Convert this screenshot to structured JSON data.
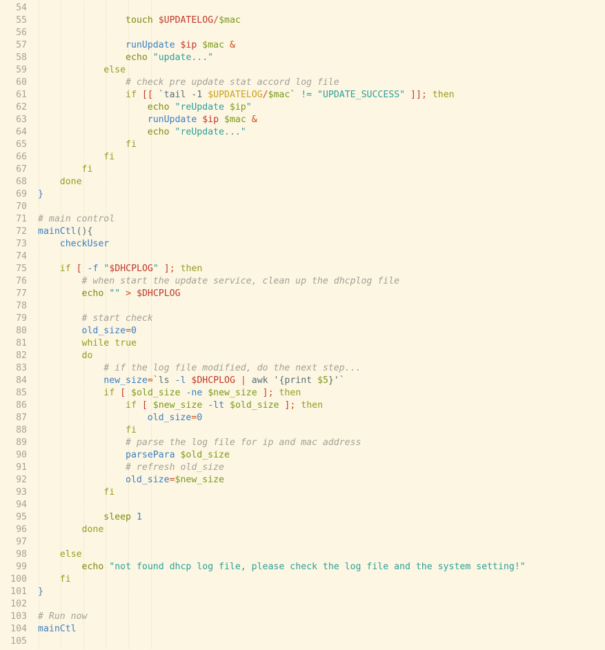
{
  "editor": {
    "theme_name": "solarized-light",
    "language": "bash",
    "colors": {
      "background": "#fdf6e3",
      "gutter_text": "#a9a295",
      "foreground": "#586e75",
      "comment": "#a2a096",
      "keyword": "#9a9a1f",
      "function": "#3a7fc1",
      "variable_green": "#7a9a1a",
      "variable_red": "#c0392b",
      "variable_gold": "#c9a21a",
      "string": "#2aa198",
      "operator": "#cb4b16",
      "bracket": "#c0392b",
      "indent_guide": "#d8d0bb"
    },
    "first_line_number": 54,
    "last_line_number": 105,
    "line_numbers": [
      54,
      55,
      56,
      57,
      58,
      59,
      60,
      61,
      62,
      63,
      64,
      65,
      66,
      67,
      68,
      69,
      70,
      71,
      72,
      73,
      74,
      75,
      76,
      77,
      78,
      79,
      80,
      81,
      82,
      83,
      84,
      85,
      86,
      87,
      88,
      89,
      90,
      91,
      92,
      93,
      94,
      95,
      96,
      97,
      98,
      99,
      100,
      101,
      102,
      103,
      104,
      105
    ],
    "lines": [
      {
        "n": 54,
        "text": ""
      },
      {
        "n": 55,
        "text": "                touch $UPDATELOG/$mac"
      },
      {
        "n": 56,
        "text": ""
      },
      {
        "n": 57,
        "text": "                runUpdate $ip $mac &"
      },
      {
        "n": 58,
        "text": "                echo \"update...\""
      },
      {
        "n": 59,
        "text": "            else"
      },
      {
        "n": 60,
        "text": "                # check pre update stat accord log file"
      },
      {
        "n": 61,
        "text": "                if [[ `tail -1 $UPDATELOG/$mac` != \"UPDATE_SUCCESS\" ]]; then"
      },
      {
        "n": 62,
        "text": "                    echo \"reUpdate $ip\""
      },
      {
        "n": 63,
        "text": "                    runUpdate $ip $mac &"
      },
      {
        "n": 64,
        "text": "                    echo \"reUpdate...\""
      },
      {
        "n": 65,
        "text": "                fi"
      },
      {
        "n": 66,
        "text": "            fi"
      },
      {
        "n": 67,
        "text": "        fi"
      },
      {
        "n": 68,
        "text": "    done"
      },
      {
        "n": 69,
        "text": "}"
      },
      {
        "n": 70,
        "text": ""
      },
      {
        "n": 71,
        "text": "# main control"
      },
      {
        "n": 72,
        "text": "mainCtl(){"
      },
      {
        "n": 73,
        "text": "    checkUser"
      },
      {
        "n": 74,
        "text": ""
      },
      {
        "n": 75,
        "text": "    if [ -f \"$DHCPLOG\" ]; then"
      },
      {
        "n": 76,
        "text": "        # when start the update service, clean up the dhcplog file"
      },
      {
        "n": 77,
        "text": "        echo \"\" > $DHCPLOG"
      },
      {
        "n": 78,
        "text": ""
      },
      {
        "n": 79,
        "text": "        # start check"
      },
      {
        "n": 80,
        "text": "        old_size=0"
      },
      {
        "n": 81,
        "text": "        while true"
      },
      {
        "n": 82,
        "text": "        do"
      },
      {
        "n": 83,
        "text": "            # if the log file modified, do the next step..."
      },
      {
        "n": 84,
        "text": "            new_size=`ls -l $DHCPLOG | awk '{print $5}'`"
      },
      {
        "n": 85,
        "text": "            if [ $old_size -ne $new_size ]; then"
      },
      {
        "n": 86,
        "text": "                if [ $new_size -lt $old_size ]; then"
      },
      {
        "n": 87,
        "text": "                    old_size=0"
      },
      {
        "n": 88,
        "text": "                fi"
      },
      {
        "n": 89,
        "text": "                # parse the log file for ip and mac address"
      },
      {
        "n": 90,
        "text": "                parsePara $old_size"
      },
      {
        "n": 91,
        "text": "                # refresh old_size"
      },
      {
        "n": 92,
        "text": "                old_size=$new_size"
      },
      {
        "n": 93,
        "text": "            fi"
      },
      {
        "n": 94,
        "text": ""
      },
      {
        "n": 95,
        "text": "            sleep 1"
      },
      {
        "n": 96,
        "text": "        done"
      },
      {
        "n": 97,
        "text": ""
      },
      {
        "n": 98,
        "text": "    else"
      },
      {
        "n": 99,
        "text": "        echo \"not found dhcp log file, please check the log file and the system setting!\""
      },
      {
        "n": 100,
        "text": "    fi"
      },
      {
        "n": 101,
        "text": "}"
      },
      {
        "n": 102,
        "text": ""
      },
      {
        "n": 103,
        "text": "# Run now"
      },
      {
        "n": 104,
        "text": "mainCtl"
      },
      {
        "n": 105,
        "text": ""
      }
    ],
    "tokens": {
      "54": [],
      "55": [
        [
          "plain",
          "                "
        ],
        [
          "builtin",
          "touch"
        ],
        [
          "plain",
          " "
        ],
        [
          "var2",
          "$UPDATELOG"
        ],
        [
          "op",
          "/"
        ],
        [
          "var",
          "$mac"
        ]
      ],
      "56": [],
      "57": [
        [
          "plain",
          "                "
        ],
        [
          "func",
          "runUpdate"
        ],
        [
          "plain",
          " "
        ],
        [
          "var2",
          "$ip"
        ],
        [
          "plain",
          " "
        ],
        [
          "var",
          "$mac"
        ],
        [
          "plain",
          " "
        ],
        [
          "op",
          "&"
        ]
      ],
      "58": [
        [
          "plain",
          "                "
        ],
        [
          "builtin",
          "echo"
        ],
        [
          "plain",
          " "
        ],
        [
          "str",
          "\"update...\""
        ]
      ],
      "59": [
        [
          "plain",
          "            "
        ],
        [
          "kw",
          "else"
        ]
      ],
      "60": [
        [
          "plain",
          "                "
        ],
        [
          "comment",
          "# check pre update stat accord log file"
        ]
      ],
      "61": [
        [
          "plain",
          "                "
        ],
        [
          "kw",
          "if"
        ],
        [
          "plain",
          " "
        ],
        [
          "brk",
          "[["
        ],
        [
          "plain",
          " `tail -1 "
        ],
        [
          "var3",
          "$UPDATELOG"
        ],
        [
          "op",
          "/"
        ],
        [
          "var",
          "$mac"
        ],
        [
          "plain",
          "` "
        ],
        [
          "str",
          "!="
        ],
        [
          "plain",
          " "
        ],
        [
          "str",
          "\"UPDATE_SUCCESS\""
        ],
        [
          "plain",
          " "
        ],
        [
          "brk",
          "]]"
        ],
        [
          "op",
          ";"
        ],
        [
          "plain",
          " "
        ],
        [
          "kw",
          "then"
        ]
      ],
      "62": [
        [
          "plain",
          "                    "
        ],
        [
          "builtin",
          "echo"
        ],
        [
          "plain",
          " "
        ],
        [
          "str",
          "\"reUpdate "
        ],
        [
          "var",
          "$ip"
        ],
        [
          "str",
          "\""
        ]
      ],
      "63": [
        [
          "plain",
          "                    "
        ],
        [
          "func",
          "runUpdate"
        ],
        [
          "plain",
          " "
        ],
        [
          "var2",
          "$ip"
        ],
        [
          "plain",
          " "
        ],
        [
          "var",
          "$mac"
        ],
        [
          "plain",
          " "
        ],
        [
          "op",
          "&"
        ]
      ],
      "64": [
        [
          "plain",
          "                    "
        ],
        [
          "builtin",
          "echo"
        ],
        [
          "plain",
          " "
        ],
        [
          "str",
          "\"reUpdate...\""
        ]
      ],
      "65": [
        [
          "plain",
          "                "
        ],
        [
          "kw",
          "fi"
        ]
      ],
      "66": [
        [
          "plain",
          "            "
        ],
        [
          "kw",
          "fi"
        ]
      ],
      "67": [
        [
          "plain",
          "        "
        ],
        [
          "kw",
          "fi"
        ]
      ],
      "68": [
        [
          "plain",
          "    "
        ],
        [
          "kw",
          "done"
        ]
      ],
      "69": [
        [
          "brace",
          "}"
        ]
      ],
      "70": [],
      "71": [
        [
          "comment",
          "# main control"
        ]
      ],
      "72": [
        [
          "func",
          "mainCtl"
        ],
        [
          "plain",
          "(){"
        ]
      ],
      "73": [
        [
          "plain",
          "    "
        ],
        [
          "func",
          "checkUser"
        ]
      ],
      "74": [],
      "75": [
        [
          "plain",
          "    "
        ],
        [
          "kw",
          "if"
        ],
        [
          "plain",
          " "
        ],
        [
          "brk",
          "["
        ],
        [
          "plain",
          " "
        ],
        [
          "opt",
          "-f"
        ],
        [
          "plain",
          " "
        ],
        [
          "str",
          "\""
        ],
        [
          "var2",
          "$DHCPLOG"
        ],
        [
          "str",
          "\""
        ],
        [
          "plain",
          " "
        ],
        [
          "brk",
          "]"
        ],
        [
          "op",
          ";"
        ],
        [
          "plain",
          " "
        ],
        [
          "kw",
          "then"
        ]
      ],
      "76": [
        [
          "plain",
          "        "
        ],
        [
          "comment",
          "# when start the update service, clean up the dhcplog file"
        ]
      ],
      "77": [
        [
          "plain",
          "        "
        ],
        [
          "builtin",
          "echo"
        ],
        [
          "plain",
          " "
        ],
        [
          "str",
          "\"\""
        ],
        [
          "plain",
          " "
        ],
        [
          "op",
          ">"
        ],
        [
          "plain",
          " "
        ],
        [
          "var2",
          "$DHCPLOG"
        ]
      ],
      "78": [],
      "79": [
        [
          "plain",
          "        "
        ],
        [
          "comment",
          "# start check"
        ]
      ],
      "80": [
        [
          "plain",
          "        "
        ],
        [
          "func",
          "old_size"
        ],
        [
          "op",
          "="
        ],
        [
          "num",
          "0"
        ]
      ],
      "81": [
        [
          "plain",
          "        "
        ],
        [
          "kw",
          "while"
        ],
        [
          "plain",
          " "
        ],
        [
          "kw",
          "true"
        ]
      ],
      "82": [
        [
          "plain",
          "        "
        ],
        [
          "kw",
          "do"
        ]
      ],
      "83": [
        [
          "plain",
          "            "
        ],
        [
          "comment",
          "# if the log file modified, do the next step..."
        ]
      ],
      "84": [
        [
          "plain",
          "            "
        ],
        [
          "func",
          "new_size"
        ],
        [
          "op",
          "="
        ],
        [
          "plain",
          "`ls "
        ],
        [
          "opt",
          "-l"
        ],
        [
          "plain",
          " "
        ],
        [
          "var2",
          "$DHCPLOG"
        ],
        [
          "plain",
          " "
        ],
        [
          "op",
          "|"
        ],
        [
          "plain",
          " awk '{print "
        ],
        [
          "var",
          "$5"
        ],
        [
          "plain",
          "}'`"
        ]
      ],
      "85": [
        [
          "plain",
          "            "
        ],
        [
          "kw",
          "if"
        ],
        [
          "plain",
          " "
        ],
        [
          "brk",
          "["
        ],
        [
          "plain",
          " "
        ],
        [
          "var",
          "$old_size"
        ],
        [
          "plain",
          " "
        ],
        [
          "opt",
          "-ne"
        ],
        [
          "plain",
          " "
        ],
        [
          "var",
          "$new_size"
        ],
        [
          "plain",
          " "
        ],
        [
          "brk",
          "]"
        ],
        [
          "op",
          ";"
        ],
        [
          "plain",
          " "
        ],
        [
          "kw",
          "then"
        ]
      ],
      "86": [
        [
          "plain",
          "                "
        ],
        [
          "kw",
          "if"
        ],
        [
          "plain",
          " "
        ],
        [
          "brk",
          "["
        ],
        [
          "plain",
          " "
        ],
        [
          "var",
          "$new_size"
        ],
        [
          "plain",
          " "
        ],
        [
          "opt",
          "-lt"
        ],
        [
          "plain",
          " "
        ],
        [
          "var",
          "$old_size"
        ],
        [
          "plain",
          " "
        ],
        [
          "brk",
          "]"
        ],
        [
          "op",
          ";"
        ],
        [
          "plain",
          " "
        ],
        [
          "kw",
          "then"
        ]
      ],
      "87": [
        [
          "plain",
          "                    "
        ],
        [
          "func",
          "old_size"
        ],
        [
          "op",
          "="
        ],
        [
          "num",
          "0"
        ]
      ],
      "88": [
        [
          "plain",
          "                "
        ],
        [
          "kw",
          "fi"
        ]
      ],
      "89": [
        [
          "plain",
          "                "
        ],
        [
          "comment",
          "# parse the log file for ip and mac address"
        ]
      ],
      "90": [
        [
          "plain",
          "                "
        ],
        [
          "func",
          "parsePara"
        ],
        [
          "plain",
          " "
        ],
        [
          "var",
          "$old_size"
        ]
      ],
      "91": [
        [
          "plain",
          "                "
        ],
        [
          "comment",
          "# refresh old_size"
        ]
      ],
      "92": [
        [
          "plain",
          "                "
        ],
        [
          "func",
          "old_size"
        ],
        [
          "op",
          "="
        ],
        [
          "var",
          "$new_size"
        ]
      ],
      "93": [
        [
          "plain",
          "            "
        ],
        [
          "kw",
          "fi"
        ]
      ],
      "94": [],
      "95": [
        [
          "plain",
          "            "
        ],
        [
          "builtin",
          "sleep"
        ],
        [
          "plain",
          " "
        ],
        [
          "num",
          "1"
        ]
      ],
      "96": [
        [
          "plain",
          "        "
        ],
        [
          "kw",
          "done"
        ]
      ],
      "97": [],
      "98": [
        [
          "plain",
          "    "
        ],
        [
          "kw",
          "else"
        ]
      ],
      "99": [
        [
          "plain",
          "        "
        ],
        [
          "builtin",
          "echo"
        ],
        [
          "plain",
          " "
        ],
        [
          "str",
          "\"not found dhcp log file, please check the log file and the system setting!\""
        ]
      ],
      "100": [
        [
          "plain",
          "    "
        ],
        [
          "kw",
          "fi"
        ]
      ],
      "101": [
        [
          "brace",
          "}"
        ]
      ],
      "102": [],
      "103": [
        [
          "comment",
          "# Run now"
        ]
      ],
      "104": [
        [
          "func",
          "mainCtl"
        ]
      ],
      "105": []
    },
    "indent_guide_columns": [
      0,
      4,
      8,
      12,
      16,
      20
    ]
  }
}
